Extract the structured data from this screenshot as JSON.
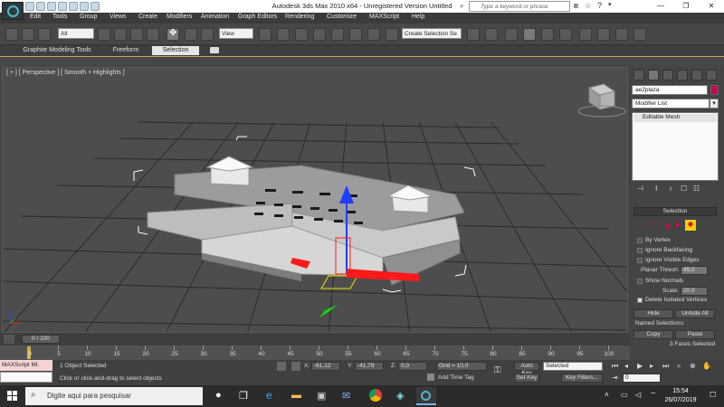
{
  "window": {
    "title": "Autodesk 3ds Max  2010 x64  - Unregistered Version    Untitled",
    "search_placeholder": "Type a keyword or phrase"
  },
  "menu": [
    "Edit",
    "Tools",
    "Group",
    "Views",
    "Create",
    "Modifiers",
    "Animation",
    "Graph Editors",
    "Rendering",
    "Customize",
    "MAXScript",
    "Help"
  ],
  "toolbar": {
    "selection_filter": "All",
    "ref_coord": "View",
    "selection_set_placeholder": "Create Selection Se"
  },
  "ribbon": {
    "tabs": [
      "Graphite Modeling Tools",
      "Freeform",
      "Selection"
    ],
    "active_tab": "Selection"
  },
  "viewport": {
    "label": "[ + ] [ Perspective ] [ Smooth + Highlights ]"
  },
  "command_panel": {
    "object_name": "ae2plaza",
    "object_color": "#c8005a",
    "modifier_list_label": "Modifier List",
    "stack_item": "Editable Mesh",
    "selection_rollout": "Selection",
    "by_vertex": "By Vertex",
    "ignore_backfacing": "Ignore Backfacing",
    "ignore_visible_edges": "Ignore Visible Edges",
    "planar_thresh_label": "Planar Thresh:",
    "planar_thresh_value": "45,0",
    "show_normals": "Show Normals",
    "scale_label": "Scale:",
    "scale_value": "20,0",
    "delete_isolated": "Delete Isolated Vertices",
    "hide_button": "Hide",
    "unhide_all_button": "Unhide All",
    "named_selections_label": "Named Selections:",
    "copy_button": "Copy",
    "paste_button": "Paste",
    "faces_selected": "3 Faces Selected"
  },
  "timeline": {
    "frame_readout": "0 / 100",
    "ticks": [
      "0",
      "5",
      "10",
      "15",
      "20",
      "25",
      "30",
      "35",
      "40",
      "45",
      "50",
      "55",
      "60",
      "65",
      "70",
      "75",
      "80",
      "85",
      "90",
      "95",
      "100"
    ]
  },
  "status": {
    "maxscript_label": "MAXScript Mi:",
    "selected_count": "1 Object Selected",
    "prompt": "Click or click-and-drag to select objects",
    "x_label": "X:",
    "x_value": "-61,12",
    "y_label": "Y:",
    "y_value": "-41,79",
    "z_label": "Z:",
    "z_value": "0,0",
    "grid": "Grid = 10,0",
    "add_time_tag": "Add Time Tag",
    "auto_key": "Auto Key",
    "set_key": "Set Key",
    "key_mode": "Selected",
    "key_filters": "Key Filters...",
    "current_frame": "0"
  },
  "taskbar": {
    "search_placeholder": "Digite aqui para pesquisar",
    "time": "15:54",
    "date": "26/07/2019"
  },
  "colors": {
    "gizmo_blue": "#1f3fff",
    "gizmo_red": "#ff1a1a",
    "gizmo_green": "#18d018",
    "selection_yellow": "#f0e000"
  }
}
